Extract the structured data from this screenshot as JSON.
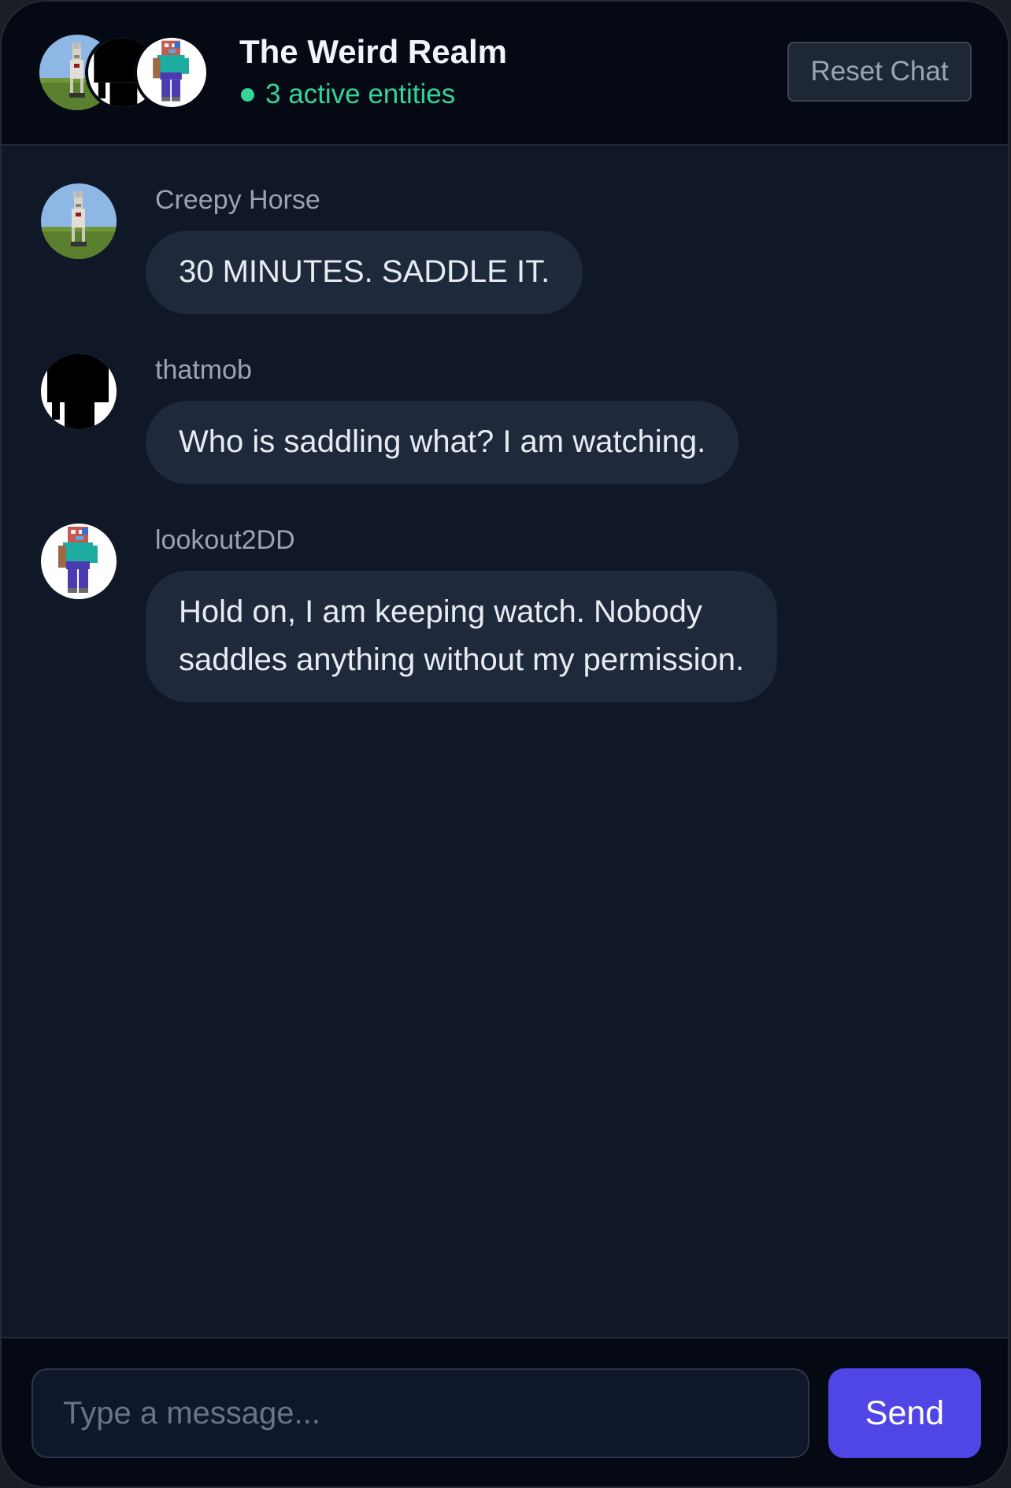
{
  "header": {
    "title": "The Weird Realm",
    "status": "3 active entities",
    "reset_label": "Reset Chat"
  },
  "participants": [
    {
      "name": "Creepy Horse",
      "avatar_icon": "horse-avatar-icon"
    },
    {
      "name": "thatmob",
      "avatar_icon": "black-mob-avatar-icon"
    },
    {
      "name": "lookout2DD",
      "avatar_icon": "blocky-character-avatar-icon"
    }
  ],
  "messages": [
    {
      "sender": "Creepy Horse",
      "text": "30 MINUTES. SADDLE IT."
    },
    {
      "sender": "thatmob",
      "text": "Who is saddling what? I am watching."
    },
    {
      "sender": "lookout2DD",
      "text": "Hold on, I am keeping watch. Nobody\nsaddles anything without my permission."
    }
  ],
  "composer": {
    "placeholder": "Type a message...",
    "value": "",
    "send_label": "Send"
  },
  "colors": {
    "accent": "#4f46e5",
    "status": "#34d399",
    "bubble": "#1e293b",
    "background": "#101828",
    "header": "#050914"
  }
}
